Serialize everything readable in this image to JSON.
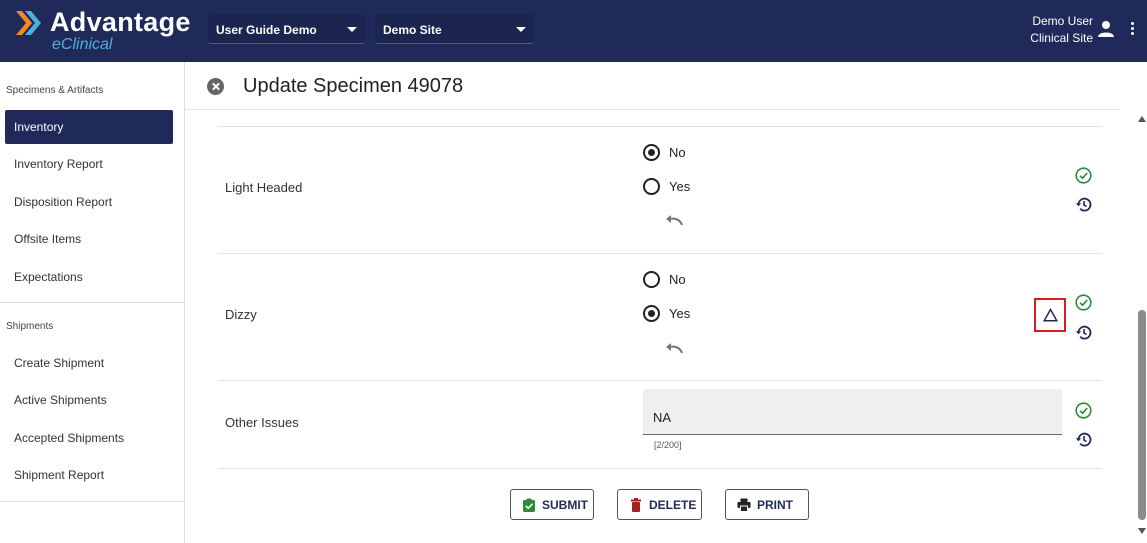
{
  "header": {
    "logo_title": "Advantage",
    "logo_subtitle": "eClinical",
    "study_select": "User Guide Demo",
    "site_select": "Demo Site",
    "user_name": "Demo User",
    "user_role": "Clinical Site"
  },
  "sidebar": {
    "section1_title": "Specimens & Artifacts",
    "section1_items": [
      {
        "label": "Inventory",
        "active": true
      },
      {
        "label": "Inventory Report"
      },
      {
        "label": "Disposition Report"
      },
      {
        "label": "Offsite Items"
      },
      {
        "label": "Expectations"
      }
    ],
    "section2_title": "Shipments",
    "section2_items": [
      {
        "label": "Create Shipment"
      },
      {
        "label": "Active Shipments"
      },
      {
        "label": "Accepted Shipments"
      },
      {
        "label": "Shipment Report"
      }
    ]
  },
  "main": {
    "title": "Update Specimen 49078",
    "fields": [
      {
        "label": "Light Headed",
        "options": [
          "No",
          "Yes"
        ],
        "selected": "No"
      },
      {
        "label": "Dizzy",
        "options": [
          "No",
          "Yes"
        ],
        "selected": "Yes"
      },
      {
        "label": "Other Issues",
        "value": "NA",
        "counter": "[2/200]"
      }
    ],
    "buttons": {
      "submit": "SUBMIT",
      "delete": "DELETE",
      "print": "PRINT"
    }
  },
  "colors": {
    "navy": "#1f2a5a",
    "accent_blue": "#4fb0d8",
    "check_green": "#2e8b3a",
    "delete_red": "#a52020",
    "highlight_red": "#d42020"
  }
}
